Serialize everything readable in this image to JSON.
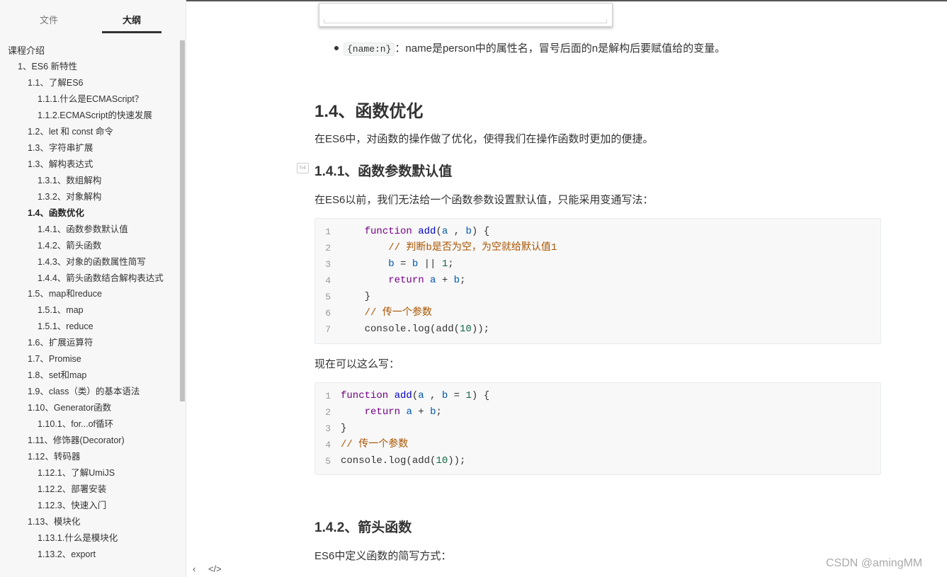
{
  "sidebar": {
    "tabs": [
      {
        "label": "文件",
        "active": false
      },
      {
        "label": "大纲",
        "active": true
      }
    ],
    "outline": [
      {
        "label": "课程介绍",
        "level": 1
      },
      {
        "label": "1、ES6 新特性",
        "level": 2
      },
      {
        "label": "1.1、了解ES6",
        "level": 3
      },
      {
        "label": "1.1.1.什么是ECMAScript？",
        "level": 4
      },
      {
        "label": "1.1.2.ECMAScript的快速发展",
        "level": 4
      },
      {
        "label": "1.2、let 和 const 命令",
        "level": 3
      },
      {
        "label": "1.3、字符串扩展",
        "level": 3
      },
      {
        "label": "1.3、解构表达式",
        "level": 3
      },
      {
        "label": "1.3.1、数组解构",
        "level": 4
      },
      {
        "label": "1.3.2、对象解构",
        "level": 4
      },
      {
        "label": "1.4、函数优化",
        "level": 3,
        "active": true
      },
      {
        "label": "1.4.1、函数参数默认值",
        "level": 4
      },
      {
        "label": "1.4.2、箭头函数",
        "level": 4
      },
      {
        "label": "1.4.3、对象的函数属性简写",
        "level": 4
      },
      {
        "label": "1.4.4、箭头函数结合解构表达式",
        "level": 4,
        "wrap": true
      },
      {
        "label": "1.5、map和reduce",
        "level": 3
      },
      {
        "label": "1.5.1、map",
        "level": 4
      },
      {
        "label": "1.5.1、reduce",
        "level": 4
      },
      {
        "label": "1.6、扩展运算符",
        "level": 3
      },
      {
        "label": "1.7、Promise",
        "level": 3
      },
      {
        "label": "1.8、set和map",
        "level": 3
      },
      {
        "label": "1.9、class（类）的基本语法",
        "level": 3
      },
      {
        "label": "1.10、Generator函数",
        "level": 3
      },
      {
        "label": "1.10.1、for...of循环",
        "level": 4
      },
      {
        "label": "1.11、修饰器(Decorator)",
        "level": 3
      },
      {
        "label": "1.12、转码器",
        "level": 3
      },
      {
        "label": "1.12.1、了解UmiJS",
        "level": 4
      },
      {
        "label": "1.12.2、部署安装",
        "level": 4
      },
      {
        "label": "1.12.3、快速入门",
        "level": 4
      },
      {
        "label": "1.13、模块化",
        "level": 3
      },
      {
        "label": "1.13.1.什么是模块化",
        "level": 4
      },
      {
        "label": "1.13.2、export",
        "level": 4
      }
    ],
    "bottom_icons": [
      "chevron-left-icon",
      "code-source-icon"
    ],
    "bottom_glyphs": {
      "back": "‹",
      "source": "</>"
    }
  },
  "content": {
    "bullet": {
      "code": "{name:n}",
      "text": "：name是person中的属性名，冒号后面的n是解构后要赋值给的变量。"
    },
    "h3": "1.4、函数优化",
    "p1": "在ES6中，对函数的操作做了优化，使得我们在操作函数时更加的便捷。",
    "h4_marker": "h4",
    "h4_1": "1.4.1、函数参数默认值",
    "p2": "在ES6以前，我们无法给一个函数参数设置默认值，只能采用变通写法：",
    "code1_lines": [
      "    function add(a , b) {",
      "        // 判断b是否为空，为空就给默认值1",
      "        b = b || 1;",
      "        return a + b;",
      "    }",
      "    // 传一个参数",
      "    console.log(add(10));"
    ],
    "p3": "现在可以这么写：",
    "code2_lines": [
      "function add(a , b = 1) {",
      "    return a + b;",
      "}",
      "// 传一个参数",
      "console.log(add(10));"
    ],
    "h4_2": "1.4.2、箭头函数",
    "p4": "ES6中定义函数的简写方式："
  },
  "watermark": "CSDN @amingMM"
}
